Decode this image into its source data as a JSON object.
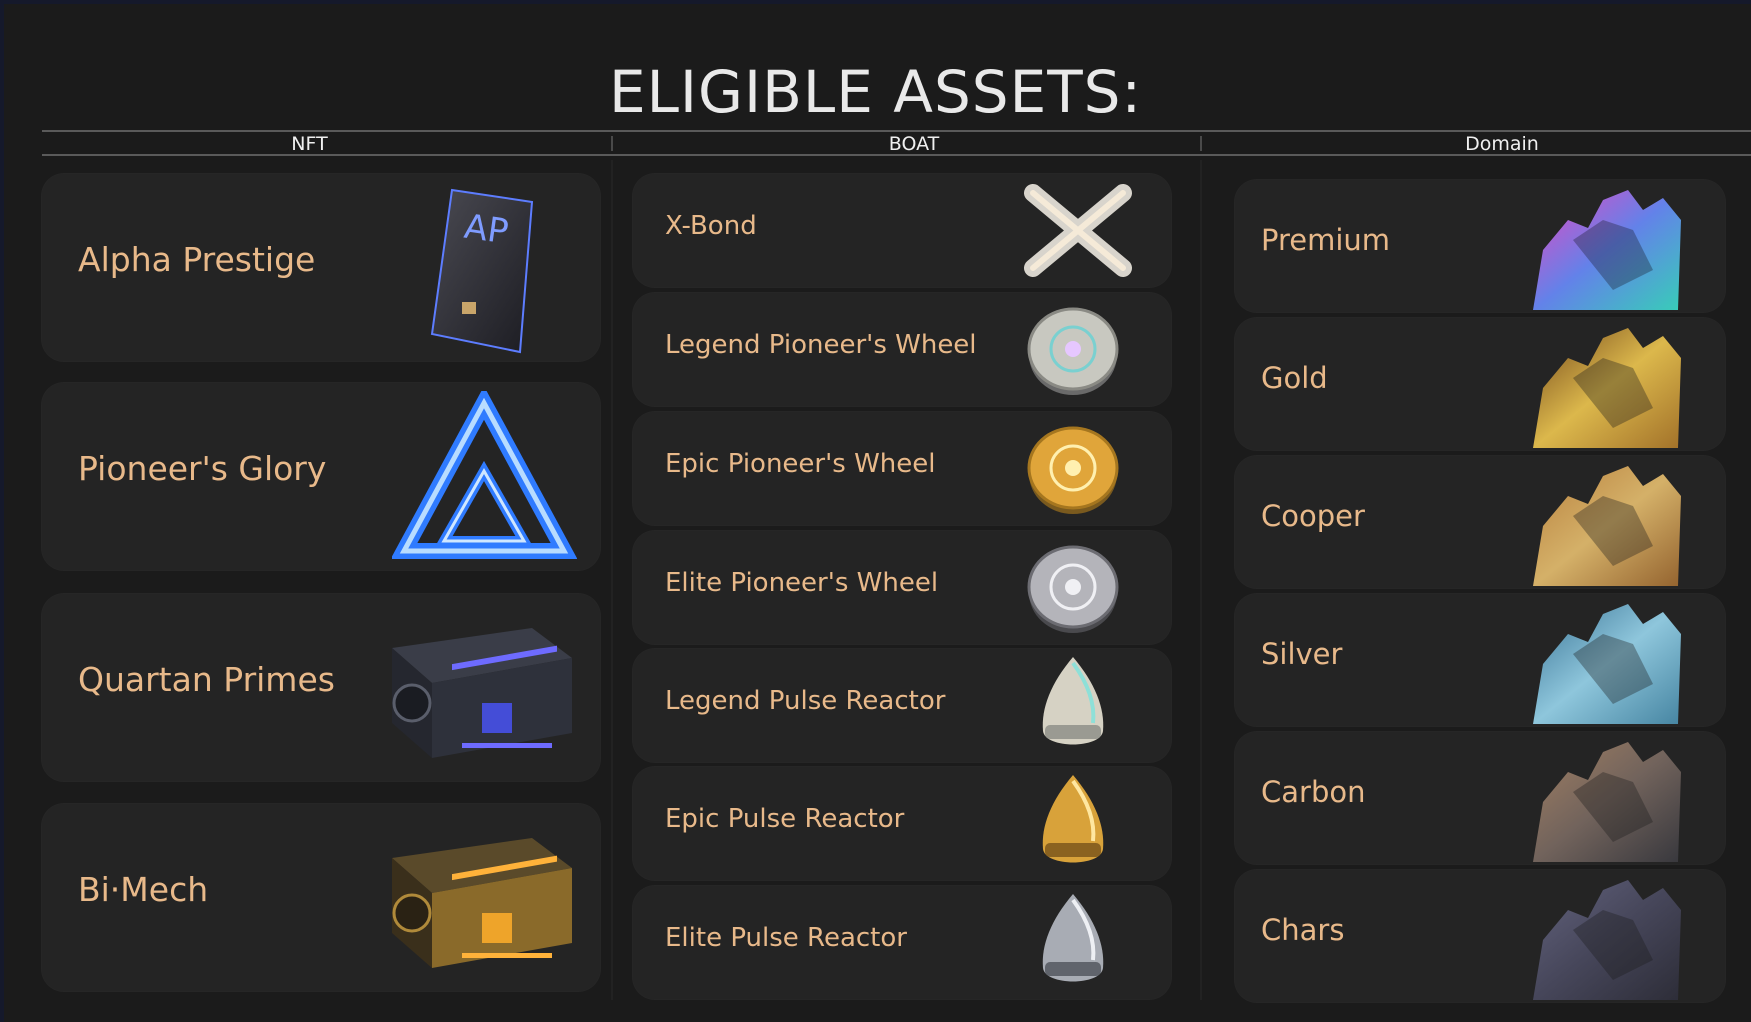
{
  "title": "ELIGIBLE ASSETS:",
  "columns": {
    "nft": "NFT",
    "boat": "BOAT",
    "domain": "Domain"
  },
  "nft_items": [
    {
      "label": "Alpha Prestige",
      "icon": "alpha-prestige-card-icon"
    },
    {
      "label": "Pioneer's Glory",
      "icon": "neon-triangle-icon"
    },
    {
      "label": "Quartan Primes",
      "icon": "blue-crate-icon"
    },
    {
      "label": "Bi·Mech",
      "icon": "gold-crate-icon"
    }
  ],
  "boat_items": [
    {
      "label": "X-Bond",
      "icon": "x-bond-icon"
    },
    {
      "label": "Legend Pioneer's Wheel",
      "icon": "legend-wheel-icon"
    },
    {
      "label": "Epic Pioneer's Wheel",
      "icon": "epic-wheel-icon"
    },
    {
      "label": "Elite Pioneer's Wheel",
      "icon": "elite-wheel-icon"
    },
    {
      "label": "Legend Pulse Reactor",
      "icon": "legend-reactor-icon"
    },
    {
      "label": "Epic Pulse Reactor",
      "icon": "epic-reactor-icon"
    },
    {
      "label": "Elite Pulse Reactor",
      "icon": "elite-reactor-icon"
    }
  ],
  "domain_items": [
    {
      "label": "Premium",
      "icon": "premium-mech-icon"
    },
    {
      "label": "Gold",
      "icon": "gold-mech-icon"
    },
    {
      "label": "Cooper",
      "icon": "cooper-mech-icon"
    },
    {
      "label": "Silver",
      "icon": "silver-mech-icon"
    },
    {
      "label": "Carbon",
      "icon": "carbon-mech-icon"
    },
    {
      "label": "Chars",
      "icon": "chars-mech-icon"
    }
  ],
  "colors": {
    "background": "#1b1b1b",
    "card": "#242424",
    "label": "#e8b98a",
    "title": "#e9e9e9"
  }
}
